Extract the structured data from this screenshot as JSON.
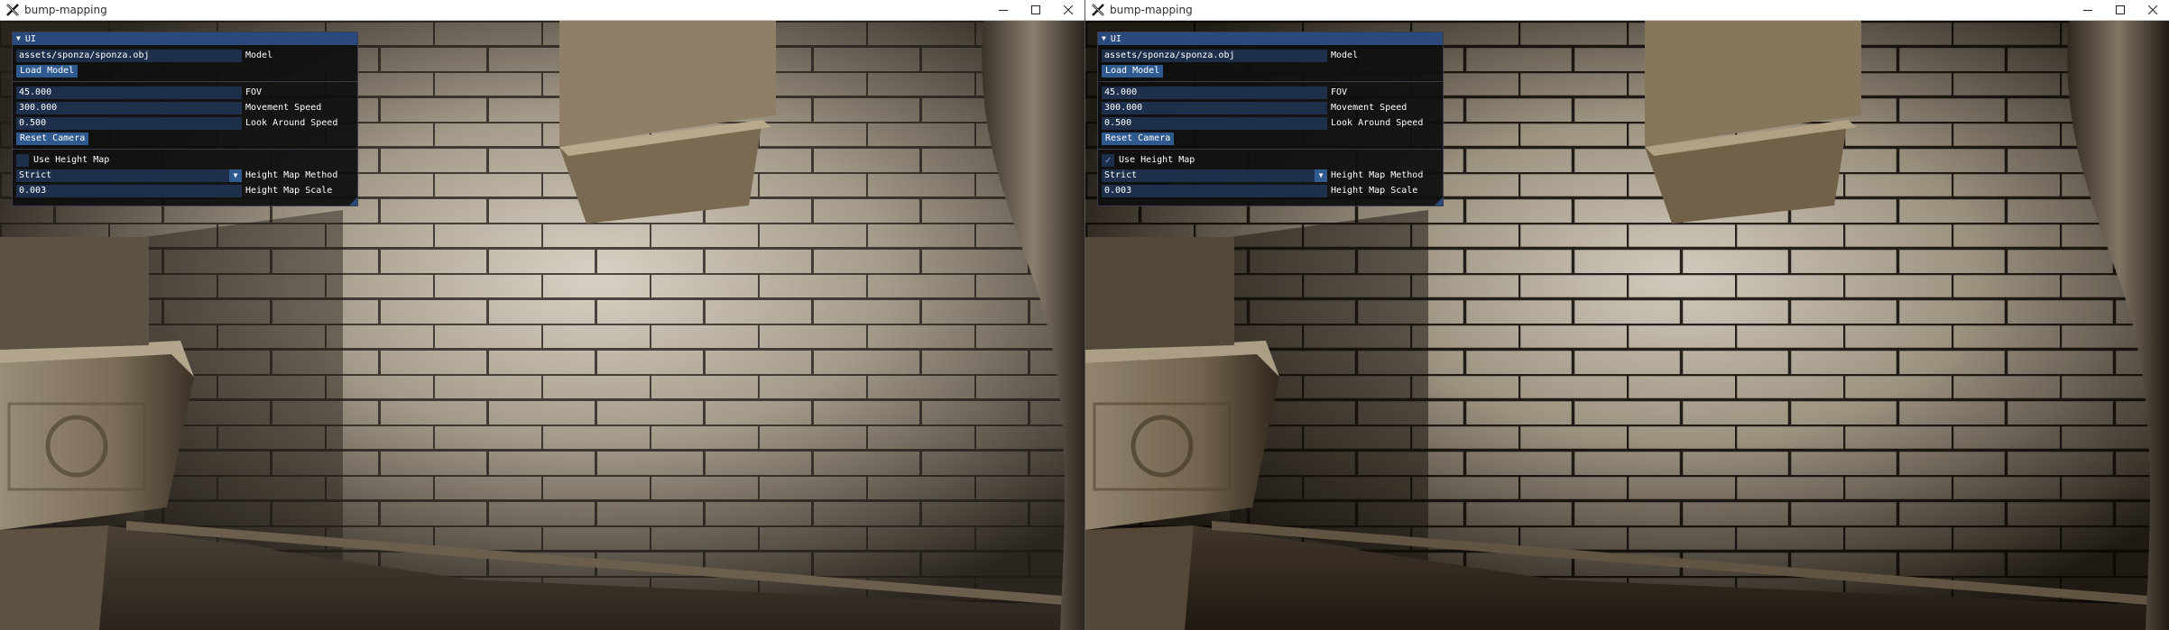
{
  "windows": [
    {
      "title": "bump-mapping",
      "ui": {
        "panel_title": "UI",
        "model_path": "assets/sponza/sponza.obj",
        "model_label": "Model",
        "load_model": "Load Model",
        "fov": "45.000",
        "fov_label": "FOV",
        "movement_speed": "300.000",
        "movement_speed_label": "Movement Speed",
        "look_speed": "0.500",
        "look_speed_label": "Look Around Speed",
        "reset_camera": "Reset Camera",
        "use_height_map_label": "Use Height Map",
        "use_height_map": false,
        "height_map_method": "Strict",
        "height_map_method_label": "Height Map Method",
        "height_map_scale": "0.003",
        "height_map_scale_label": "Height Map Scale"
      }
    },
    {
      "title": "bump-mapping",
      "ui": {
        "panel_title": "UI",
        "model_path": "assets/sponza/sponza.obj",
        "model_label": "Model",
        "load_model": "Load Model",
        "fov": "45.000",
        "fov_label": "FOV",
        "movement_speed": "300.000",
        "movement_speed_label": "Movement Speed",
        "look_speed": "0.500",
        "look_speed_label": "Look Around Speed",
        "reset_camera": "Reset Camera",
        "use_height_map_label": "Use Height Map",
        "use_height_map": true,
        "height_map_method": "Strict",
        "height_map_method_label": "Height Map Method",
        "height_map_scale": "0.003",
        "height_map_scale_label": "Height Map Scale"
      }
    }
  ],
  "icons": {
    "app": "x-app-icon",
    "minimize": "minimize-icon",
    "maximize": "maximize-icon",
    "close": "close-icon",
    "combo": "triangle-down-icon",
    "checkmark": "checkmark-icon"
  },
  "colors": {
    "panel_bg": "#0f0f0f",
    "title_bar_active": "#294a7a",
    "frame_bg": "#1d2f4b",
    "button": "#2f5a8f",
    "check_mark": "#6fa2e8"
  }
}
